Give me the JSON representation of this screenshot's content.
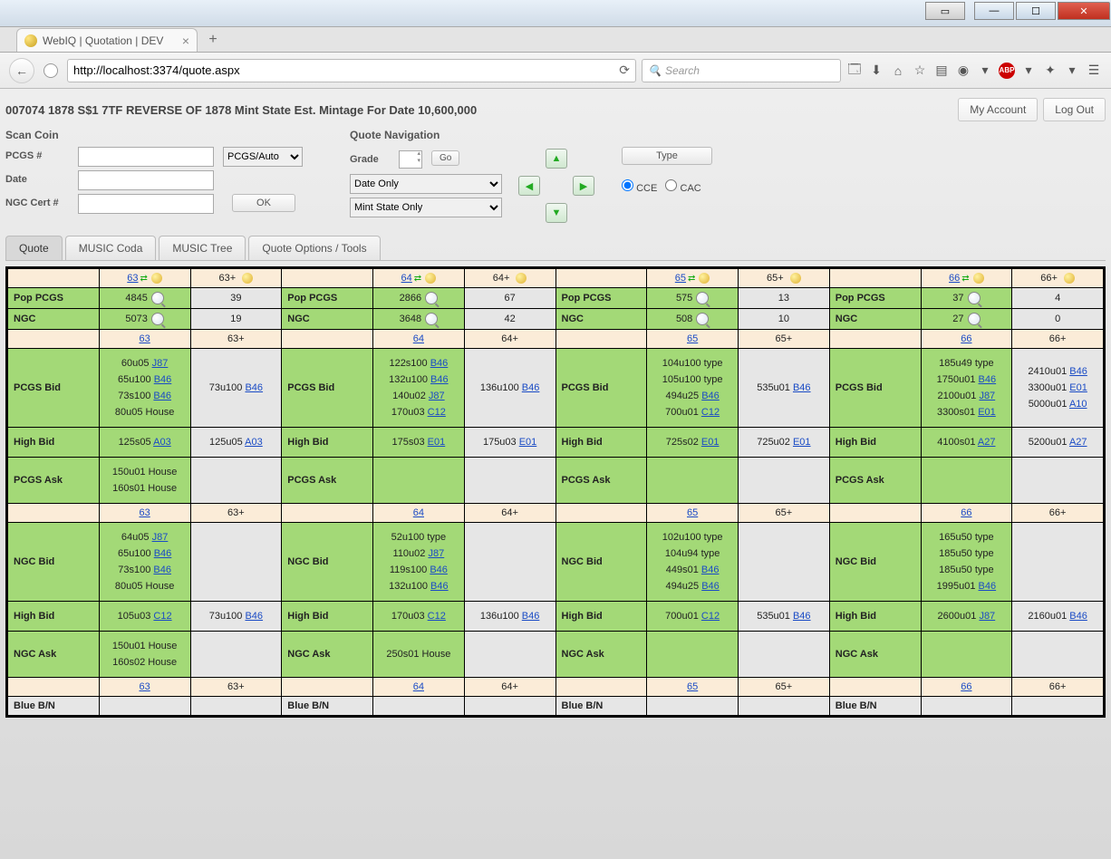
{
  "window": {
    "tab_title": "WebIQ | Quotation | DEV",
    "url": "http://localhost:3374/quote.aspx",
    "search_placeholder": "Search"
  },
  "header": {
    "title": "007074 1878 S$1 7TF REVERSE OF 1878 Mint State Est. Mintage For Date 10,600,000",
    "my_account": "My Account",
    "log_out": "Log Out"
  },
  "scan": {
    "section": "Scan Coin",
    "pcgs_label": "PCGS #",
    "date_label": "Date",
    "ngc_label": "NGC Cert #",
    "pcgs_auto": "PCGS/Auto",
    "ok": "OK"
  },
  "quotenav": {
    "section": "Quote Navigation",
    "grade_label": "Grade",
    "go": "Go",
    "date_only": "Date Only",
    "mint_state": "Mint State Only",
    "type_btn": "Type",
    "cce": "CCE",
    "cac": "CAC"
  },
  "tabs": {
    "quote": "Quote",
    "coda": "MUSIC Coda",
    "tree": "MUSIC Tree",
    "options": "Quote Options / Tools"
  },
  "grid": {
    "grades": [
      "63",
      "63+",
      "64",
      "64+",
      "65",
      "65+",
      "66",
      "66+"
    ],
    "row_labels": {
      "pop_pcgs": "Pop PCGS",
      "ngc": "NGC",
      "pcgs_bid": "PCGS Bid",
      "high_bid": "High Bid",
      "pcgs_ask": "PCGS Ask",
      "ngc_bid": "NGC Bid",
      "ngc_ask": "NGC Ask",
      "blue": "Blue B/N"
    },
    "pop_pcgs": {
      "63": "4845",
      "63p": "39",
      "64": "2866",
      "64p": "67",
      "65": "575",
      "65p": "13",
      "66": "37",
      "66p": "4"
    },
    "ngc": {
      "63": "5073",
      "63p": "19",
      "64": "3648",
      "64p": "42",
      "65": "508",
      "65p": "10",
      "66": "27",
      "66p": "0"
    },
    "pcgs_bid": {
      "63": [
        {
          "t": "60u05",
          "l": "J87"
        },
        {
          "t": "65u100",
          "l": "B46"
        },
        {
          "t": "73s100",
          "l": "B46"
        },
        {
          "t": "80u05 House"
        }
      ],
      "63p": [
        {
          "t": "73u100",
          "l": "B46"
        }
      ],
      "64": [
        {
          "t": "122s100",
          "l": "B46"
        },
        {
          "t": "132u100",
          "l": "B46"
        },
        {
          "t": "140u02",
          "l": "J87"
        },
        {
          "t": "170u03",
          "l": "C12"
        }
      ],
      "64p": [
        {
          "t": "136u100",
          "l": "B46"
        }
      ],
      "65": [
        {
          "t": "104u100 type"
        },
        {
          "t": "105u100 type"
        },
        {
          "t": "494u25",
          "l": "B46"
        },
        {
          "t": "700u01",
          "l": "C12"
        }
      ],
      "65p": [
        {
          "t": "535u01",
          "l": "B46"
        }
      ],
      "66": [
        {
          "t": "185u49 type"
        },
        {
          "t": "1750u01",
          "l": "B46"
        },
        {
          "t": "2100u01",
          "l": "J87"
        },
        {
          "t": "3300s01",
          "l": "E01"
        }
      ],
      "66p": [
        {
          "t": "2410u01",
          "l": "B46"
        },
        {
          "t": "3300u01",
          "l": "E01"
        },
        {
          "t": "5000u01",
          "l": "A10"
        }
      ]
    },
    "high_bid": {
      "63": {
        "t": "125s05",
        "l": "A03"
      },
      "63p": {
        "t": "125u05",
        "l": "A03"
      },
      "64": {
        "t": "175s03",
        "l": "E01"
      },
      "64p": {
        "t": "175u03",
        "l": "E01"
      },
      "65": {
        "t": "725s02",
        "l": "E01"
      },
      "65p": {
        "t": "725u02",
        "l": "E01"
      },
      "66": {
        "t": "4100s01",
        "l": "A27"
      },
      "66p": {
        "t": "5200u01",
        "l": "A27"
      }
    },
    "pcgs_ask": {
      "63": [
        {
          "t": "150u01 House"
        },
        {
          "t": "160s01 House"
        }
      ],
      "64": [],
      "65": [],
      "66": []
    },
    "ngc_bid": {
      "63": [
        {
          "t": "64u05",
          "l": "J87"
        },
        {
          "t": "65u100",
          "l": "B46"
        },
        {
          "t": "73s100",
          "l": "B46"
        },
        {
          "t": "80u05 House"
        }
      ],
      "64": [
        {
          "t": "52u100 type"
        },
        {
          "t": "110u02",
          "l": "J87"
        },
        {
          "t": "119s100",
          "l": "B46"
        },
        {
          "t": "132u100",
          "l": "B46"
        }
      ],
      "65": [
        {
          "t": "102u100 type"
        },
        {
          "t": "104u94 type"
        },
        {
          "t": "449s01",
          "l": "B46"
        },
        {
          "t": "494u25",
          "l": "B46"
        }
      ],
      "66": [
        {
          "t": "165u50 type"
        },
        {
          "t": "185u50 type"
        },
        {
          "t": "185u50 type"
        },
        {
          "t": "1995u01",
          "l": "B46"
        }
      ]
    },
    "ngc_high_bid": {
      "63": {
        "t": "105u03",
        "l": "C12"
      },
      "63p": {
        "t": "73u100",
        "l": "B46"
      },
      "64": {
        "t": "170u03",
        "l": "C12"
      },
      "64p": {
        "t": "136u100",
        "l": "B46"
      },
      "65": {
        "t": "700u01",
        "l": "C12"
      },
      "65p": {
        "t": "535u01",
        "l": "B46"
      },
      "66": {
        "t": "2600u01",
        "l": "J87"
      },
      "66p": {
        "t": "2160u01",
        "l": "B46"
      }
    },
    "ngc_ask": {
      "63": [
        {
          "t": "150u01 House"
        },
        {
          "t": "160s02 House"
        }
      ],
      "64": [
        {
          "t": "250s01 House"
        }
      ],
      "65": [],
      "66": []
    }
  }
}
